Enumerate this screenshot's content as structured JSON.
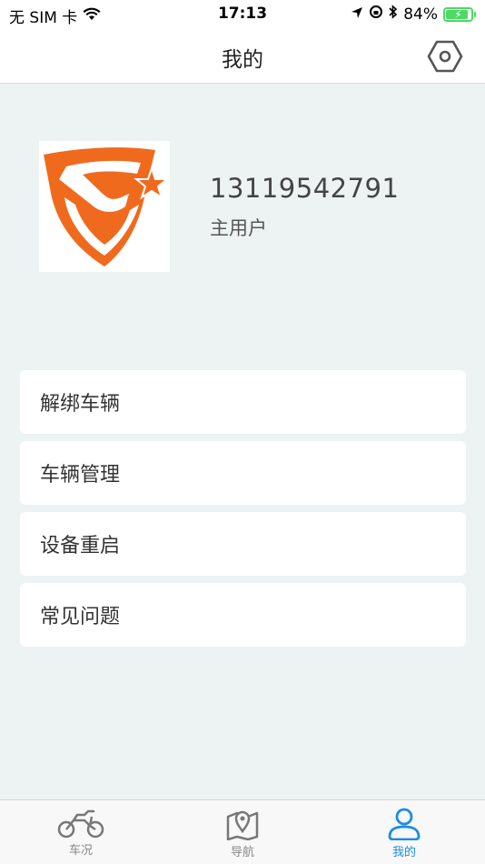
{
  "status_bar": {
    "carrier": "无 SIM 卡",
    "time": "17:13",
    "battery": "84%"
  },
  "nav": {
    "title": "我的"
  },
  "profile": {
    "phone": "13119542791",
    "role": "主用户"
  },
  "menu": [
    {
      "label": "解绑车辆"
    },
    {
      "label": "车辆管理"
    },
    {
      "label": "设备重启"
    },
    {
      "label": "常见问题"
    }
  ],
  "tabs": [
    {
      "label": "车况",
      "icon": "motorcycle-icon",
      "active": false
    },
    {
      "label": "导航",
      "icon": "map-pin-icon",
      "active": false
    },
    {
      "label": "我的",
      "icon": "user-icon",
      "active": true
    }
  ],
  "colors": {
    "accent": "#1a8ce8",
    "logo_orange": "#f06a1e",
    "background": "#ecf3f2"
  }
}
